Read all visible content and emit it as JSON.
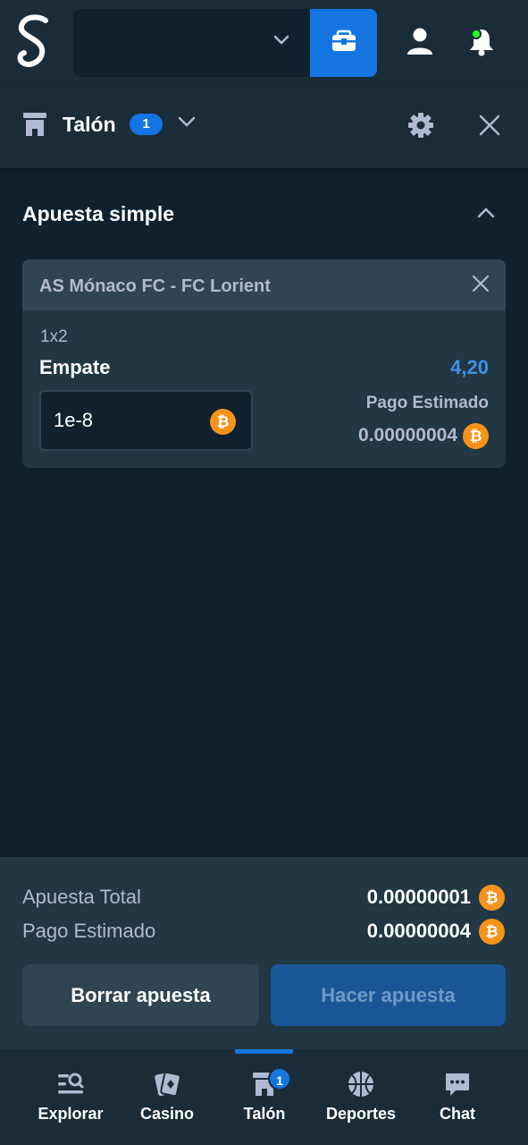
{
  "colors": {
    "background": "#0f212e",
    "panel": "#1a2c38",
    "card": "#213743",
    "card_header": "#2f4553",
    "accent_blue": "#1475e1",
    "odds_blue": "#4391e7",
    "muted_text": "#b1bad3",
    "bitcoin": "#f7931a",
    "online_dot": "#1fff20"
  },
  "topbar": {
    "logo_icon": "stake-logo-icon",
    "currency_select_icon": "chevron-down-icon",
    "wallet_icon": "wallet-icon",
    "user_icon": "user-icon",
    "notifications_icon": "bell-icon"
  },
  "betslip": {
    "title": "Talón",
    "count": "1",
    "tab": "Apuesta simple",
    "bet": {
      "match": "AS Mónaco FC - FC Lorient",
      "market": "1x2",
      "selection": "Empate",
      "odds": "4,20",
      "stake_value": "1e-8",
      "payout_label": "Pago Estimado",
      "payout_value": "0.00000004"
    }
  },
  "summary": {
    "total_stake_label": "Apuesta Total",
    "total_stake_value": "0.00000001",
    "est_payout_label": "Pago Estimado",
    "est_payout_value": "0.00000004",
    "clear_label": "Borrar apuesta",
    "place_label": "Hacer apuesta"
  },
  "nav": {
    "items": [
      {
        "label": "Explorar",
        "icon": "browse-icon"
      },
      {
        "label": "Casino",
        "icon": "cards-icon"
      },
      {
        "label": "Talón",
        "icon": "betslip-icon",
        "active": true,
        "badge": "1"
      },
      {
        "label": "Deportes",
        "icon": "basketball-icon"
      },
      {
        "label": "Chat",
        "icon": "chat-icon"
      }
    ]
  }
}
